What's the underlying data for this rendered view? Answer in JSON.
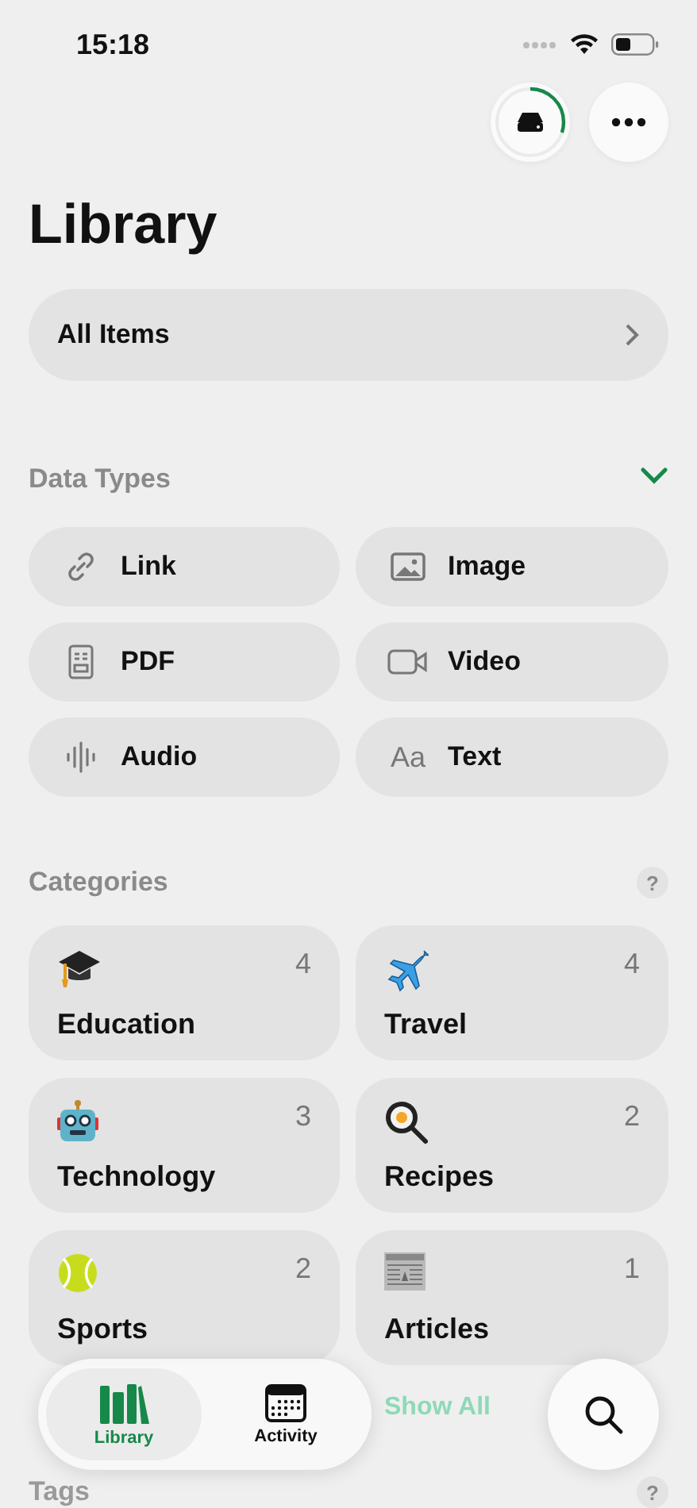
{
  "status_bar": {
    "time": "15:18"
  },
  "toolbar": {
    "storage": {
      "level": 0.3
    }
  },
  "title": "Library",
  "all_items": {
    "label": "All Items"
  },
  "data_types": {
    "title": "Data Types",
    "expanded": true,
    "items": [
      {
        "label": "Link"
      },
      {
        "label": "Image"
      },
      {
        "label": "PDF"
      },
      {
        "label": "Video"
      },
      {
        "label": "Audio"
      },
      {
        "label": "Text",
        "icon_text": "Aa"
      }
    ]
  },
  "categories": {
    "title": "Categories",
    "help": "?",
    "items": [
      {
        "label": "Education",
        "count": "4"
      },
      {
        "label": "Travel",
        "count": "4"
      },
      {
        "label": "Technology",
        "count": "3"
      },
      {
        "label": "Recipes",
        "count": "2"
      },
      {
        "label": "Sports",
        "count": "2"
      },
      {
        "label": "Articles",
        "count": "1"
      }
    ],
    "show_all": "Show All"
  },
  "tags": {
    "title": "Tags",
    "help": "?"
  },
  "tab_bar": [
    {
      "label": "Library",
      "selected": true
    },
    {
      "label": "Activity",
      "selected": false
    }
  ]
}
